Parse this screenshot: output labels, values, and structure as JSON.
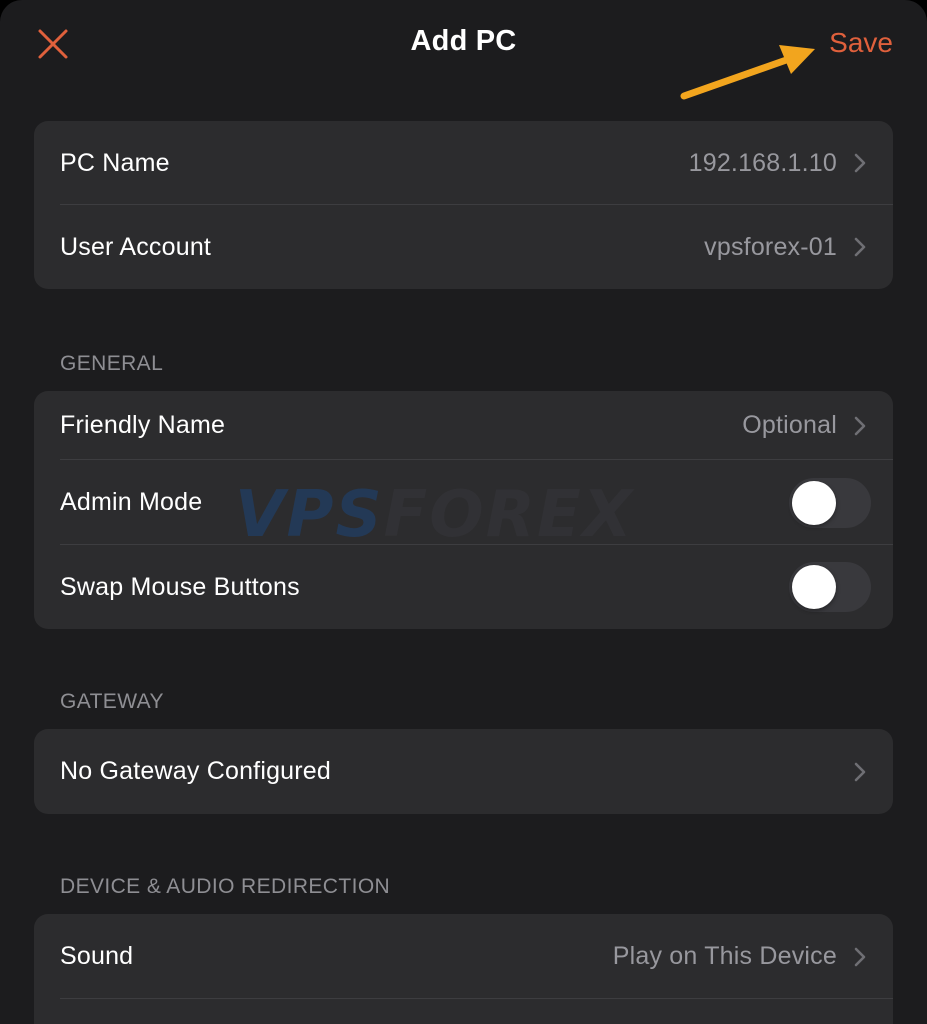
{
  "colors": {
    "accent": "#e0603c",
    "annotation_arrow": "#f2a51e",
    "background": "#1c1c1e",
    "cell_background": "#2c2c2e",
    "secondary_text": "#98989e"
  },
  "nav": {
    "title": "Add PC",
    "save_label": "Save",
    "close_icon": "close-icon"
  },
  "connection": {
    "rows": [
      {
        "label": "PC Name",
        "value": "192.168.1.10"
      },
      {
        "label": "User Account",
        "value": "vpsforex-01"
      }
    ]
  },
  "general": {
    "header": "GENERAL",
    "friendly_name": {
      "label": "Friendly Name",
      "value": "Optional"
    },
    "admin_mode": {
      "label": "Admin Mode",
      "on": false
    },
    "swap_mouse": {
      "label": "Swap Mouse Buttons",
      "on": false
    }
  },
  "gateway": {
    "header": "GATEWAY",
    "row": {
      "label": "No Gateway Configured"
    }
  },
  "device_audio": {
    "header": "DEVICE & AUDIO REDIRECTION",
    "sound": {
      "label": "Sound",
      "value": "Play on This Device"
    }
  },
  "watermark": {
    "part1": "VPS",
    "part2": "FOREX"
  }
}
